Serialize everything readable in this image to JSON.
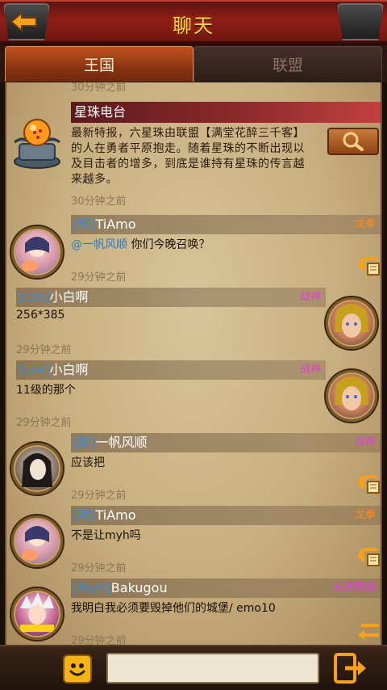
{
  "header": {
    "title": "聊天"
  },
  "tabs": [
    {
      "label": "王国",
      "active": true
    },
    {
      "label": "联盟",
      "active": false
    }
  ],
  "radio": {
    "prev_time": "30分钟之前",
    "title": "星珠电台",
    "text": "最新特报，六星珠由联盟【满堂花醉三千客】的人在勇者平原抱走。随着星珠的不断出现以及目击者的增多，到底是谁持有星珠的传言越来越多。",
    "time": "30分钟之前"
  },
  "messages": [
    {
      "tag": "[明]",
      "name": "TiAmo",
      "rank": "龙拳",
      "mention": "@一帆风顺",
      "text": " 你们今晚召唤？",
      "time": "29分钟之前"
    },
    {
      "tag": "[cze]",
      "name": "小白啊",
      "rank": "战神",
      "text": "256*385",
      "time": "29分钟之前"
    },
    {
      "tag": "[cze]",
      "name": "小白啊",
      "rank": "战神",
      "text": "11级的那个",
      "time": "29分钟之前"
    },
    {
      "tag": "[醉]",
      "name": "一帆风顺",
      "rank": "战神",
      "text": "应该把",
      "time": "29分钟之前"
    },
    {
      "tag": "[明]",
      "name": "TiAmo",
      "rank": "龙拳",
      "text": "不是让myh吗",
      "time": "29分钟之前"
    },
    {
      "tag": "[MyH]",
      "name": "Bakugou",
      "rank": "成员荣耀",
      "text": "我明白我必须要毁掉他们的城堡/ emo10",
      "time": "29分钟之前"
    }
  ],
  "footer": {
    "input_placeholder": ""
  },
  "colors": {
    "header_red": "#8e1e16",
    "title_gold": "#ffd24a",
    "tag_blue": "#3a8cd8",
    "rank_orange": "#ff8a1c",
    "rank_pink": "#e040d8",
    "parchment": "#c8af80"
  },
  "icons": [
    "back-arrow-icon",
    "search-magnifier-icon",
    "dragon-ball-icon",
    "reply-icon",
    "emoji-icon",
    "send-icon"
  ]
}
